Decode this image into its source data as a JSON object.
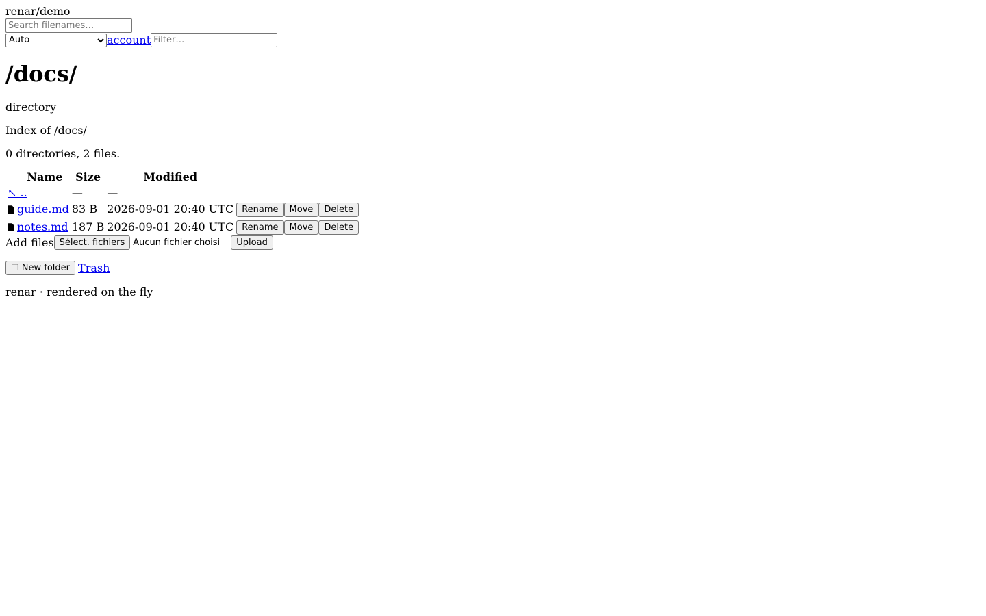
{
  "header": {
    "repo": "renar/demo",
    "search_placeholder": "Search filenames…",
    "theme_select": "Auto",
    "account_link": "account",
    "filter_placeholder": "Filter…"
  },
  "main": {
    "title": "/docs/",
    "type": "directory",
    "index_text": "Index of /docs/",
    "summary": "0 directories, 2 files."
  },
  "table": {
    "columns": [
      "Name",
      "Size",
      "Modified"
    ],
    "parent": {
      "label": "↖ ..",
      "size": "—",
      "modified": "—"
    },
    "rows": [
      {
        "name": "guide.md",
        "size": "83 B",
        "modified": "2026-09-01 20:40 UTC",
        "rename": "Rename",
        "move": "Move",
        "delete": "Delete"
      },
      {
        "name": "notes.md",
        "size": "187 B",
        "modified": "2026-09-01 20:40 UTC",
        "rename": "Rename",
        "move": "Move",
        "delete": "Delete"
      }
    ]
  },
  "upload": {
    "label": "Add files",
    "choose_button": "Sélect. fichiers",
    "no_file_text": "Aucun fichier choisi",
    "upload_button": "Upload"
  },
  "actions": {
    "new_folder": "☐ New folder",
    "trash_link": "Trash"
  },
  "footer": {
    "text": "renar · rendered on the fly"
  }
}
